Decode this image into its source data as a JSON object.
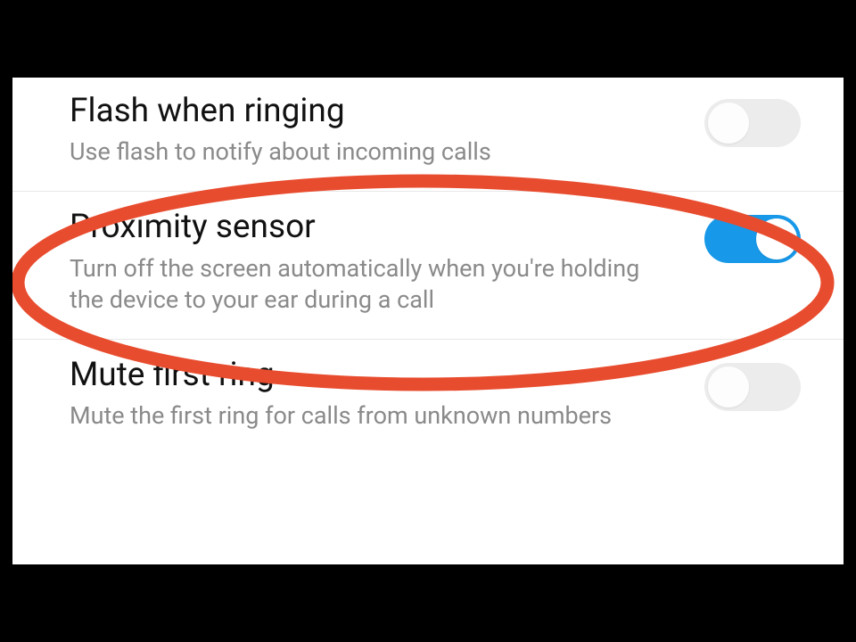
{
  "settings": [
    {
      "title": "Flash when ringing",
      "description": "Use flash to notify about incoming calls",
      "enabled": false
    },
    {
      "title": "Proximity sensor",
      "description": "Turn off the screen automatically when you're holding the device to your ear during a call",
      "enabled": true
    },
    {
      "title": "Mute first ring",
      "description": "Mute the first ring for calls from unknown numbers",
      "enabled": false
    }
  ],
  "annotation": {
    "highlight_color": "#e84c2e",
    "highlighted_item_index": 1
  }
}
